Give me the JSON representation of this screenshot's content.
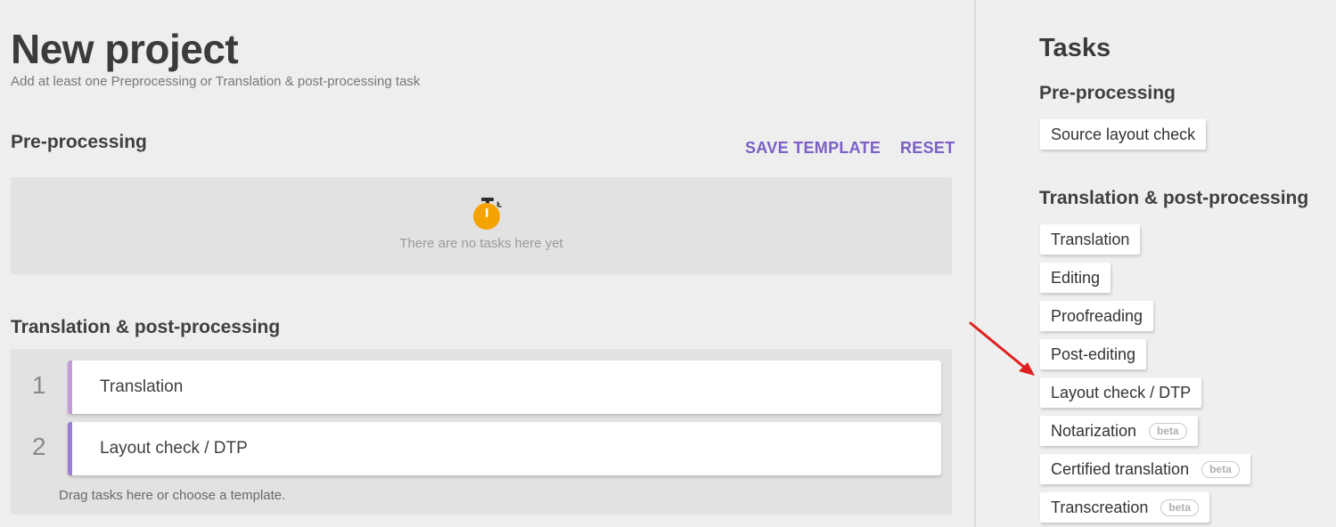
{
  "header": {
    "title": "New project",
    "subtitle": "Add at least one Preprocessing or Translation & post-processing task"
  },
  "preprocessing": {
    "heading": "Pre-processing",
    "save_template_label": "SAVE TEMPLATE",
    "reset_label": "RESET",
    "empty_icon": "stopwatch-icon",
    "empty_text": "There are no tasks here yet"
  },
  "translation": {
    "heading": "Translation & post-processing",
    "tasks": [
      {
        "number": "1",
        "label": "Translation",
        "accent": "#c59ad8"
      },
      {
        "number": "2",
        "label": "Layout check / DTP",
        "accent": "#9a7ed6"
      }
    ],
    "drag_hint": "Drag tasks here or choose a template."
  },
  "panel": {
    "title": "Tasks",
    "preprocessing_heading": "Pre-processing",
    "preprocessing_items": [
      {
        "label": "Source layout check"
      }
    ],
    "translation_heading": "Translation & post-processing",
    "translation_items": [
      {
        "label": "Translation"
      },
      {
        "label": "Editing"
      },
      {
        "label": "Proofreading"
      },
      {
        "label": "Post-editing"
      },
      {
        "label": "Layout check / DTP"
      },
      {
        "label": "Notarization",
        "badge": "beta"
      },
      {
        "label": "Certified translation",
        "badge": "beta"
      },
      {
        "label": "Transcreation",
        "badge": "beta"
      }
    ]
  },
  "colors": {
    "accent": "#7b5fc4",
    "icon": "#f5a300",
    "annotation_arrow": "#e02020"
  }
}
